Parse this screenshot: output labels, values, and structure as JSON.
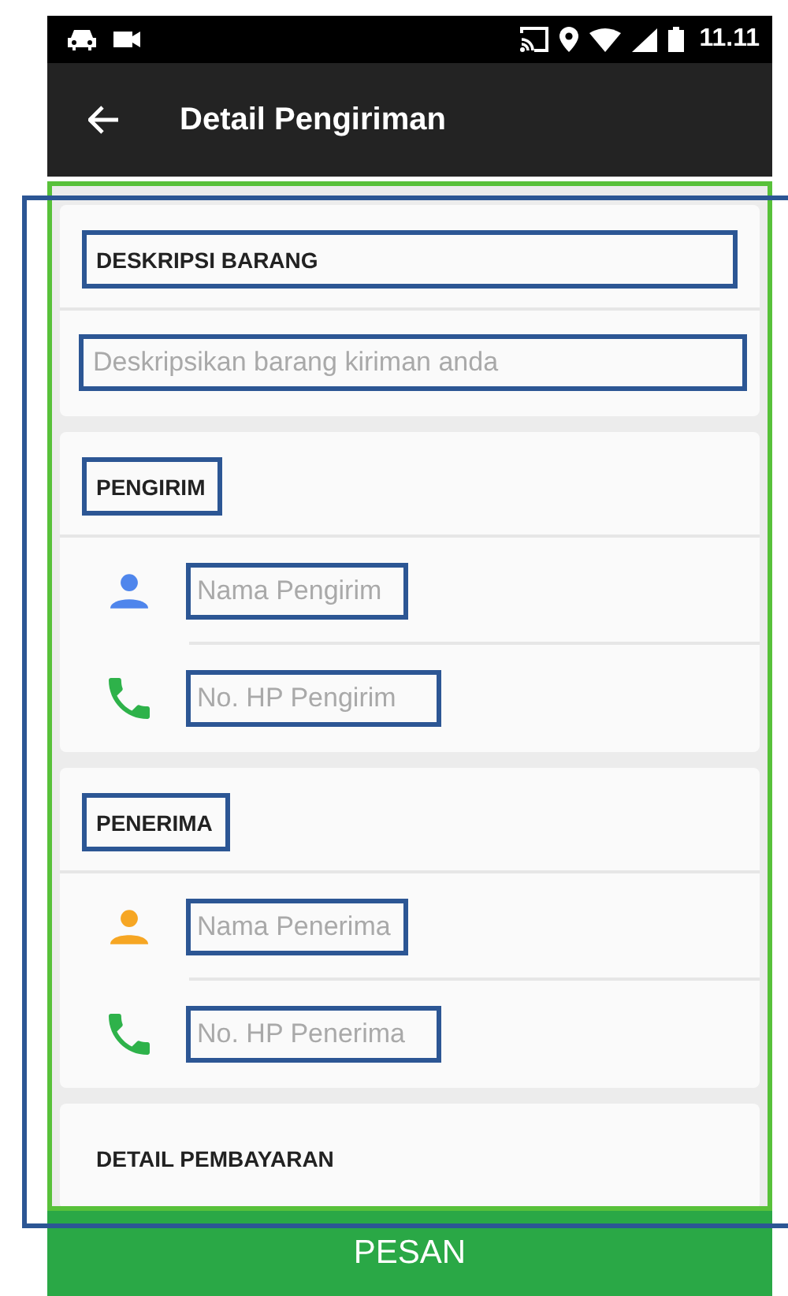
{
  "status_bar": {
    "time": "11.11"
  },
  "app_bar": {
    "title": "Detail Pengiriman"
  },
  "sections": [
    {
      "title": "DESKRIPSI BARANG",
      "highlighted": true,
      "fields": [
        {
          "kind": "text",
          "placeholder": "Deskripsikan barang kiriman anda",
          "highlighted": true
        }
      ]
    },
    {
      "title": "PENGIRIM",
      "highlighted": true,
      "fields": [
        {
          "kind": "name",
          "placeholder": "Nama Pengirim",
          "highlighted": true,
          "color": "#4f86ec"
        },
        {
          "kind": "phone",
          "placeholder": "No. HP Pengirim",
          "highlighted": true,
          "color": "#2eb24a"
        }
      ]
    },
    {
      "title": "PENERIMA",
      "highlighted": true,
      "fields": [
        {
          "kind": "name",
          "placeholder": "Nama Penerima",
          "highlighted": true,
          "color": "#f6a623"
        },
        {
          "kind": "phone",
          "placeholder": "No. HP Penerima",
          "highlighted": true,
          "color": "#2eb24a"
        }
      ]
    },
    {
      "title": "DETAIL PEMBAYARAN",
      "highlighted": false
    }
  ],
  "submit_button": "PESAN"
}
